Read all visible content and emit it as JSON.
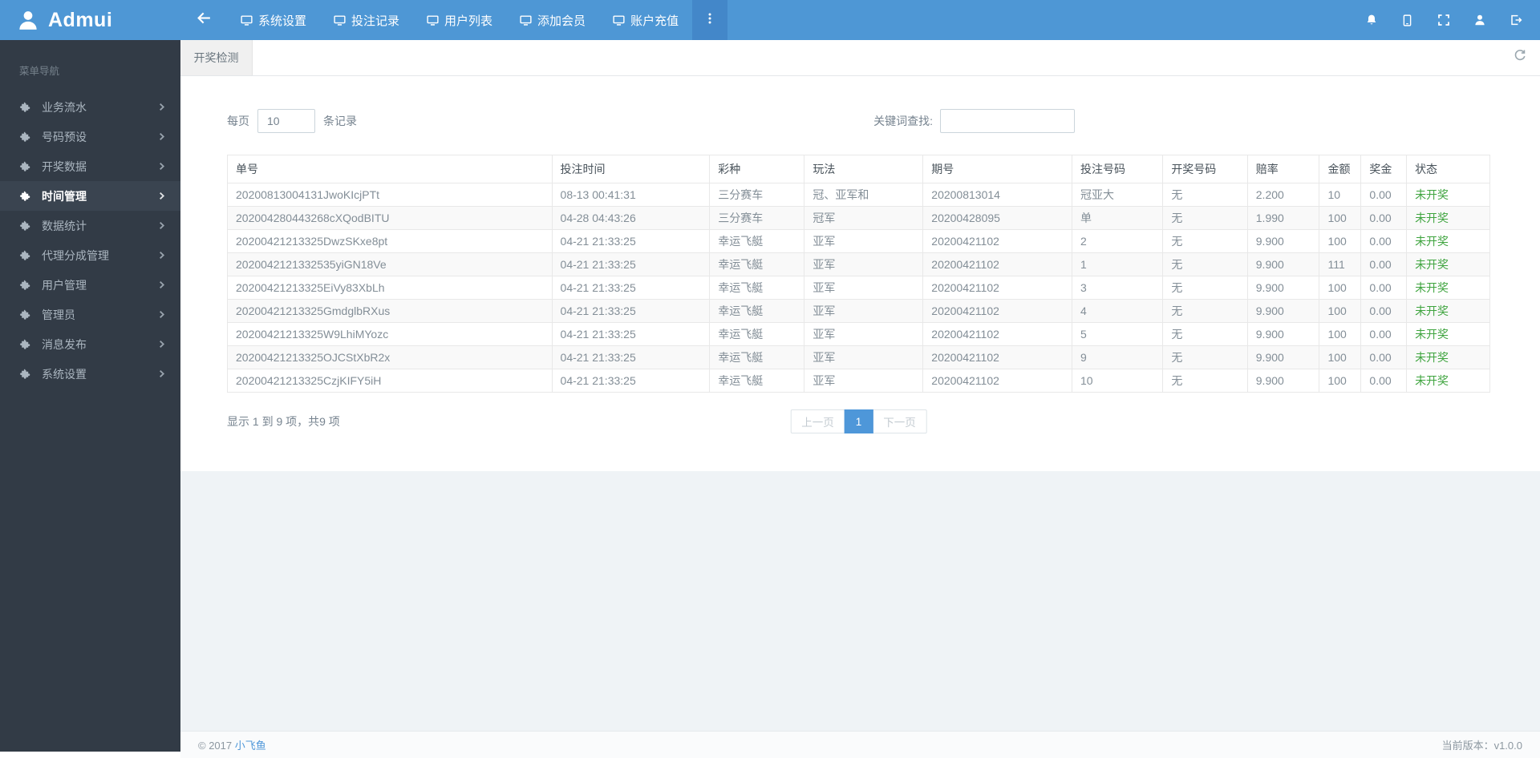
{
  "topbar": {
    "logo_text": "Admui",
    "nav_items": [
      "系统设置",
      "投注记录",
      "用户列表",
      "添加会员",
      "账户充值"
    ],
    "right_icons": [
      "bell-icon",
      "tablet-icon",
      "fullscreen-icon",
      "user-icon",
      "logout-icon"
    ]
  },
  "sidebar": {
    "header": "菜单导航",
    "items": [
      {
        "label": "业务流水",
        "active": false
      },
      {
        "label": "号码预设",
        "active": false
      },
      {
        "label": "开奖数据",
        "active": false
      },
      {
        "label": "时间管理",
        "active": true
      },
      {
        "label": "数据统计",
        "active": false
      },
      {
        "label": "代理分成管理",
        "active": false
      },
      {
        "label": "用户管理",
        "active": false
      },
      {
        "label": "管理员",
        "active": false
      },
      {
        "label": "消息发布",
        "active": false
      },
      {
        "label": "系统设置",
        "active": false
      }
    ]
  },
  "tabbar": {
    "active_tab": "开奖检测"
  },
  "toolbar": {
    "per_page_prefix": "每页",
    "per_page_value": "10",
    "per_page_suffix": "条记录",
    "search_label": "关键词查找:",
    "search_value": ""
  },
  "table": {
    "headers": [
      "单号",
      "投注时间",
      "彩种",
      "玩法",
      "期号",
      "投注号码",
      "开奖号码",
      "赔率",
      "金额",
      "奖金",
      "状态"
    ],
    "rows": [
      [
        "20200813004131JwoKIcjPTt",
        "08-13 00:41:31",
        "三分赛车",
        "冠、亚军和",
        "20200813014",
        "冠亚大",
        "无",
        "2.200",
        "10",
        "0.00",
        "未开奖"
      ],
      [
        "202004280443268cXQodBITU",
        "04-28 04:43:26",
        "三分赛车",
        "冠军",
        "20200428095",
        "单",
        "无",
        "1.990",
        "100",
        "0.00",
        "未开奖"
      ],
      [
        "20200421213325DwzSKxe8pt",
        "04-21 21:33:25",
        "幸运飞艇",
        "亚军",
        "20200421102",
        "2",
        "无",
        "9.900",
        "100",
        "0.00",
        "未开奖"
      ],
      [
        "2020042121332535yiGN18Ve",
        "04-21 21:33:25",
        "幸运飞艇",
        "亚军",
        "20200421102",
        "1",
        "无",
        "9.900",
        "111",
        "0.00",
        "未开奖"
      ],
      [
        "20200421213325EiVy83XbLh",
        "04-21 21:33:25",
        "幸运飞艇",
        "亚军",
        "20200421102",
        "3",
        "无",
        "9.900",
        "100",
        "0.00",
        "未开奖"
      ],
      [
        "20200421213325GmdglbRXus",
        "04-21 21:33:25",
        "幸运飞艇",
        "亚军",
        "20200421102",
        "4",
        "无",
        "9.900",
        "100",
        "0.00",
        "未开奖"
      ],
      [
        "20200421213325W9LhiMYozc",
        "04-21 21:33:25",
        "幸运飞艇",
        "亚军",
        "20200421102",
        "5",
        "无",
        "9.900",
        "100",
        "0.00",
        "未开奖"
      ],
      [
        "20200421213325OJCStXbR2x",
        "04-21 21:33:25",
        "幸运飞艇",
        "亚军",
        "20200421102",
        "9",
        "无",
        "9.900",
        "100",
        "0.00",
        "未开奖"
      ],
      [
        "20200421213325CzjKIFY5iH",
        "04-21 21:33:25",
        "幸运飞艇",
        "亚军",
        "20200421102",
        "10",
        "无",
        "9.900",
        "100",
        "0.00",
        "未开奖"
      ]
    ]
  },
  "summary": "显示 1 到 9 项，共9 项",
  "pagination": {
    "prev": "上一页",
    "current": "1",
    "next": "下一页"
  },
  "footer": {
    "copyright": "© 2017",
    "brand_link": "小飞鱼",
    "version": "当前版本：v1.0.0"
  },
  "colors": {
    "topbar_blue": "#4E97D5",
    "topbar_more_blue": "#4387C9",
    "sidebar_dark": "#323B46",
    "sidebar_active": "#3A4450",
    "status_green": "#3EA43E",
    "pagination_active_blue": "#4E97D9",
    "link_blue": "#4E97D9",
    "content_gray": "#EFF3F6"
  }
}
